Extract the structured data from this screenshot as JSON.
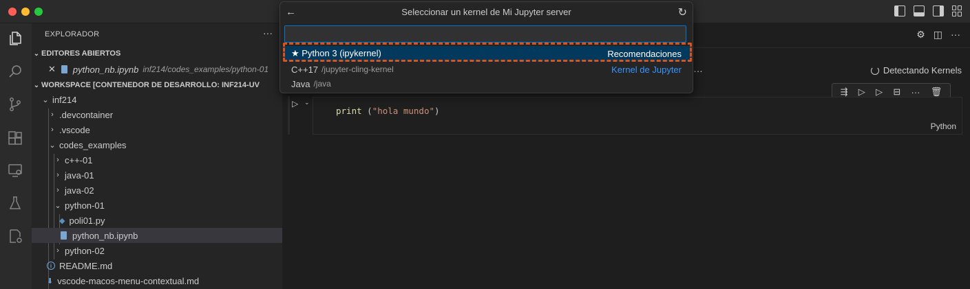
{
  "window": {
    "colors": {
      "red": "#ff5f57",
      "yellow": "#febc2e",
      "green": "#28c840",
      "accent": "#0078d4",
      "highlight": "#d9531e",
      "link": "#3794ff"
    }
  },
  "activity_bar": {
    "items": [
      {
        "icon": "files-icon"
      },
      {
        "icon": "search-icon"
      },
      {
        "icon": "source-control-icon"
      },
      {
        "icon": "extensions-icon"
      },
      {
        "icon": "remote-explorer-icon"
      },
      {
        "icon": "testing-flask-icon"
      },
      {
        "icon": "remote-settings-icon"
      }
    ]
  },
  "sidebar": {
    "title": "EXPLORADOR",
    "more": "···",
    "open_editors": {
      "header": "EDITORES ABIERTOS",
      "file_name": "python_nb.ipynb",
      "file_path": "inf214/codes_examples/python-01"
    },
    "workspace": {
      "header": "WORKSPACE [CONTENEDOR DE DESARROLLO: INF214-UV",
      "items": [
        {
          "label": "inf214"
        },
        {
          "label": ".devcontainer"
        },
        {
          "label": ".vscode"
        },
        {
          "label": "codes_examples"
        },
        {
          "label": "c++-01"
        },
        {
          "label": "java-01"
        },
        {
          "label": "java-02"
        },
        {
          "label": "python-01"
        },
        {
          "label": "poli01.py"
        },
        {
          "label": "python_nb.ipynb"
        },
        {
          "label": "python-02"
        },
        {
          "label": "README.md"
        },
        {
          "label": "vscode-macos-menu-contextual.md"
        }
      ]
    }
  },
  "quick_pick": {
    "title": "Seleccionar un kernel de Mi Jupyter server",
    "input_value": "",
    "items": [
      {
        "label": "★ Python 3 (ipykernel)",
        "description": "",
        "right": "Recomendaciones"
      },
      {
        "label": "C++17",
        "description": "/jupyter-cling-kernel",
        "right": "Kernel de Jupyter"
      },
      {
        "label": "Java",
        "description": "/java",
        "right": ""
      }
    ]
  },
  "editor": {
    "status": "Detectando Kernels",
    "cell": {
      "code_fn": "print",
      "code_open": " (",
      "code_str": "\"hola mundo\"",
      "code_close": ")",
      "language": "Python"
    }
  }
}
